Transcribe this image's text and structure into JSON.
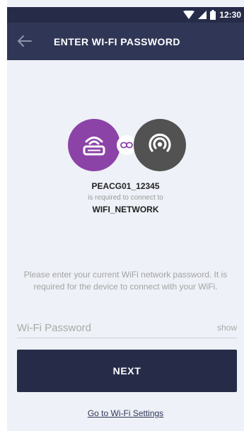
{
  "status_bar": {
    "time": "12:30",
    "icons": [
      "wifi-icon",
      "signal-icon",
      "battery-icon"
    ]
  },
  "header": {
    "title": "ENTER WI-FI PASSWORD",
    "back_icon": "arrow-left-icon"
  },
  "pairing": {
    "device_icon": "device-router-icon",
    "link_icon": "link-icon",
    "network_icon": "wifi-broadcast-icon",
    "device_name": "PEACG01_12345",
    "required_text": "is required to connect to",
    "network_name": "WIFI_NETWORK"
  },
  "form": {
    "instructions": "Please enter your current WiFi network password. It is required for the device to connect with your WiFi.",
    "password_placeholder": "Wi-Fi Password",
    "password_value": "",
    "show_label": "show",
    "next_label": "NEXT",
    "settings_link": "Go to Wi-Fi Settings"
  },
  "colors": {
    "app_bar": "#303756",
    "status_bar": "#262c48",
    "background": "#eef1f7",
    "device_circle": "#8c43a7",
    "network_circle": "#525252",
    "primary_button": "#262c48"
  }
}
